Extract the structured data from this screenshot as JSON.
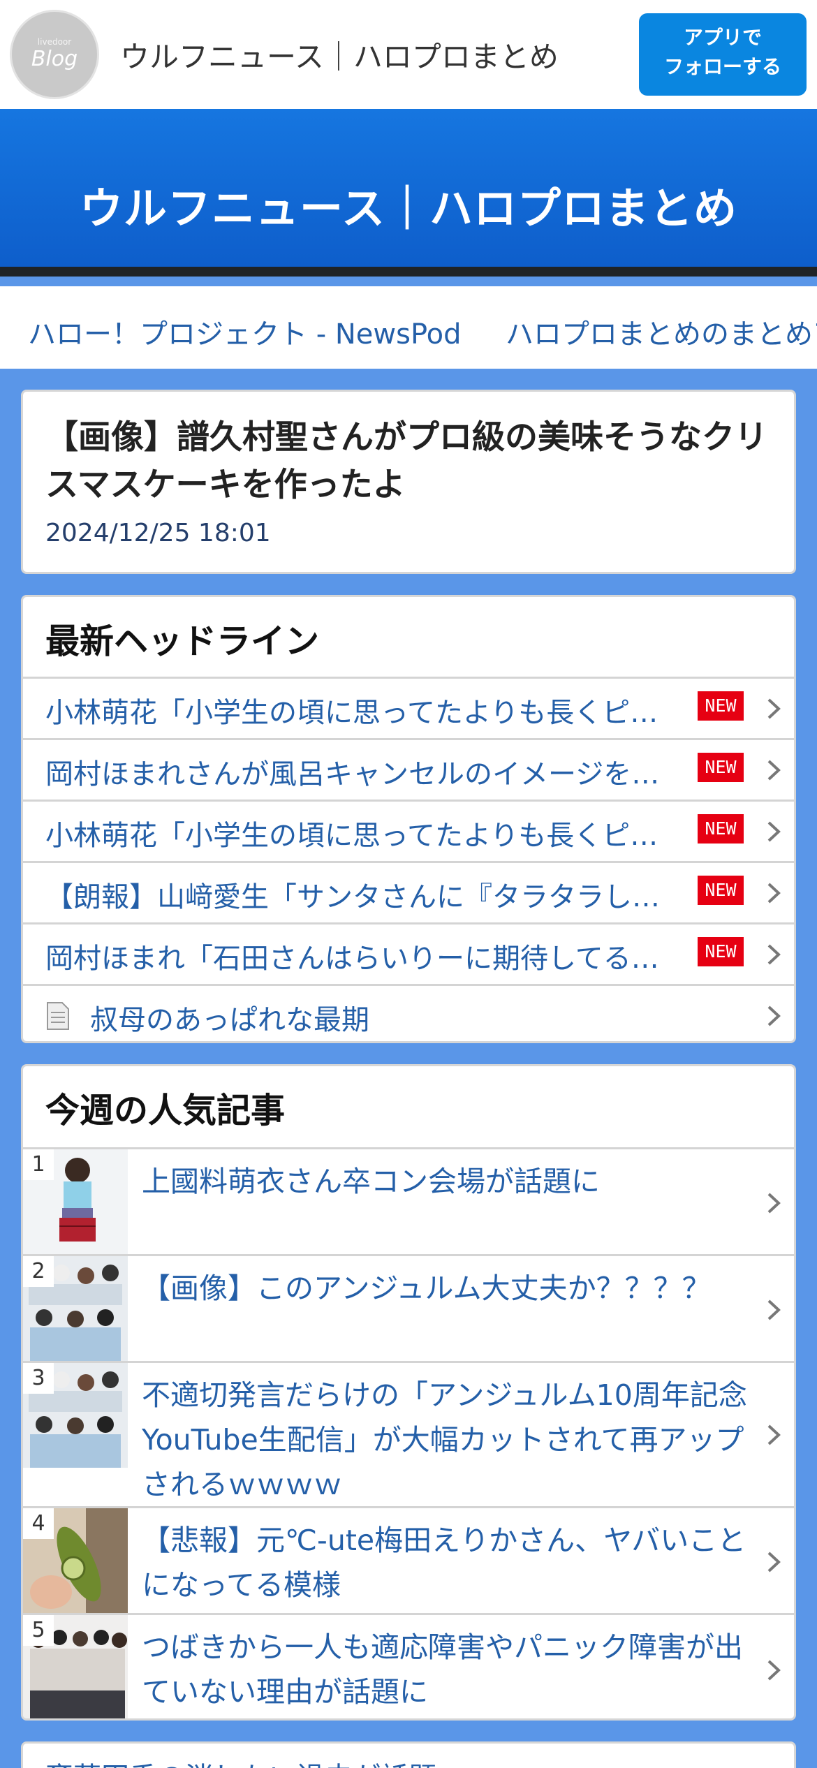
{
  "topbar": {
    "logo_small": "livedoor",
    "logo_big": "Blog",
    "site_name": "ウルフニュース｜ハロプロまとめ",
    "follow_label_1": "アプリで",
    "follow_label_2": "フォローする"
  },
  "banner": {
    "title": "ウルフニュース｜ハロプロまとめ"
  },
  "nav": {
    "links": [
      "ハロー！プロジェクト - NewsPod",
      "ハロプロまとめのまとめア"
    ]
  },
  "article": {
    "title": "【画像】譜久村聖さんがプロ級の美味そうなクリスマスケーキを作ったよ",
    "date": "2024/12/25 18:01"
  },
  "headlines": {
    "heading": "最新ヘッドライン",
    "new_label": "NEW",
    "items": [
      {
        "text": "小林萌花「小学生の頃に思ってたよりも長くピ…",
        "is_new": true
      },
      {
        "text": "岡村ほまれさんが風呂キャンセルのイメージを…",
        "is_new": true
      },
      {
        "text": "小林萌花「小学生の頃に思ってたよりも長くピ…",
        "is_new": true
      },
      {
        "text": "【朗報】山﨑愛生「サンタさんに『タラタラし…",
        "is_new": true
      },
      {
        "text": "岡村ほまれ「石田さんはらいりーに期待してる…",
        "is_new": true
      },
      {
        "text": "叔母のあっぱれな最期",
        "is_new": false,
        "icon": "document-icon"
      }
    ]
  },
  "popular": {
    "heading": "今週の人気記事",
    "items": [
      {
        "rank": "1",
        "text": "上國料萌衣さん卒コン会場が話題に"
      },
      {
        "rank": "2",
        "text": "【画像】このアンジュルム大丈夫か？？？？"
      },
      {
        "rank": "3",
        "text": "不適切発言だらけの「アンジュルム10周年記念YouTube生配信」が大幅カットされて再アップされるｗｗｗｗ"
      },
      {
        "rank": "4",
        "text": "【悲報】元℃-ute梅田えりかさん、ヤバいことになってる模様"
      },
      {
        "rank": "5",
        "text": "つばきから一人も適応障害やパニック障害が出ていない理由が話題に"
      }
    ]
  },
  "next_item": {
    "text": "斎藤円香の消したい過去が話題"
  },
  "colors": {
    "accent": "#0a86e0",
    "link": "#245fa8",
    "background": "#5a96e8",
    "new_badge": "#e60012"
  }
}
